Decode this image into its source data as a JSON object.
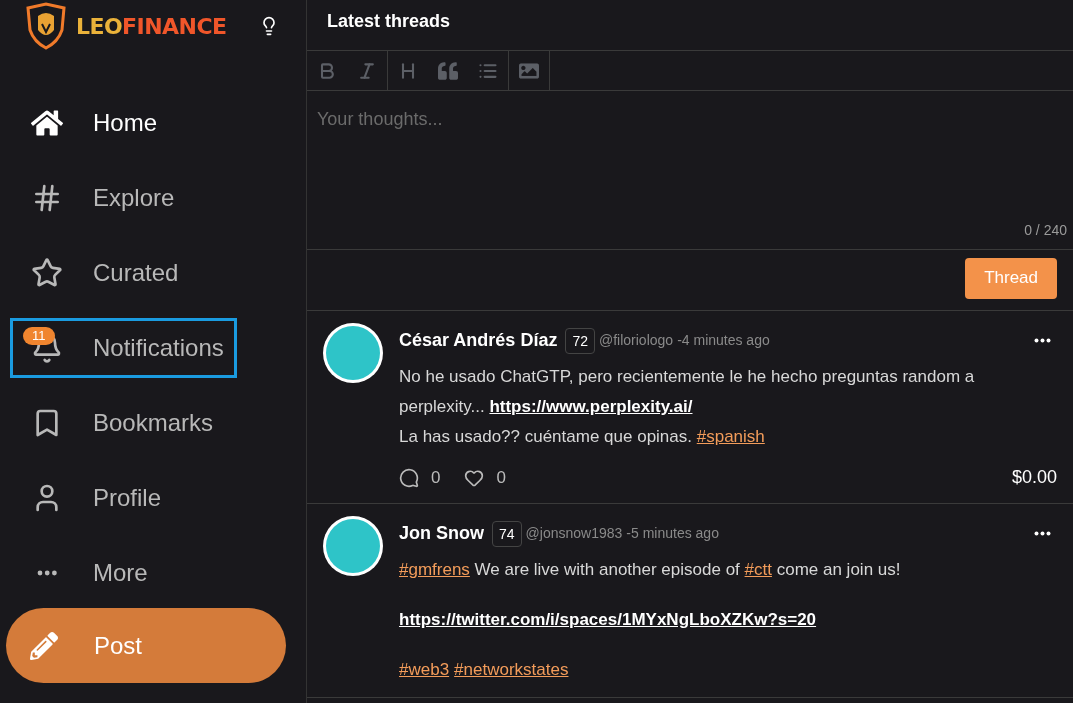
{
  "logo": {
    "first": "LEO",
    "second": "FINANCE"
  },
  "nav": [
    {
      "label": "Home",
      "selected": true,
      "focused": false
    },
    {
      "label": "Explore",
      "selected": false,
      "focused": false
    },
    {
      "label": "Curated",
      "selected": false,
      "focused": false
    },
    {
      "label": "Notifications",
      "selected": false,
      "focused": true,
      "badge": "11"
    },
    {
      "label": "Bookmarks",
      "selected": false,
      "focused": false
    },
    {
      "label": "Profile",
      "selected": false,
      "focused": false
    },
    {
      "label": "More",
      "selected": false,
      "focused": false
    }
  ],
  "post_button": "Post",
  "header": {
    "title": "Latest threads"
  },
  "editor": {
    "placeholder": "Your thoughts...",
    "counter": "0 / 240",
    "submit": "Thread"
  },
  "posts": [
    {
      "name": "César Andrés Díaz",
      "reputation": "72",
      "handle": "@filoriologo",
      "time": "-4 minutes ago",
      "paragraphs": [
        [
          [
            {
              "kind": "text",
              "text": "No he usado ChatGTP, pero recientemente le he hecho preguntas random a perplexity... "
            },
            {
              "kind": "link",
              "text": "https://www.perplexity.ai/"
            }
          ],
          [
            {
              "kind": "text",
              "text": "La has usado?? cuéntame que opinas. "
            },
            {
              "kind": "tag",
              "text": "#spanish"
            }
          ]
        ]
      ],
      "comments": "0",
      "likes": "0",
      "payout": "$0.00"
    },
    {
      "name": "Jon Snow",
      "reputation": "74",
      "handle": "@jonsnow1983",
      "time": "-5 minutes ago",
      "paragraphs": [
        [
          [
            {
              "kind": "tag",
              "text": "#gmfrens"
            },
            {
              "kind": "text",
              "text": " We are live with another episode of "
            },
            {
              "kind": "tag",
              "text": "#ctt"
            },
            {
              "kind": "text",
              "text": " come an join us!"
            }
          ]
        ],
        [
          [
            {
              "kind": "link",
              "text": "https://twitter.com/i/spaces/1MYxNgLboXZKw?s=20"
            }
          ]
        ],
        [
          [
            {
              "kind": "tag",
              "text": "#web3"
            },
            {
              "kind": "tag",
              "text": "#networkstates"
            }
          ]
        ]
      ]
    }
  ]
}
